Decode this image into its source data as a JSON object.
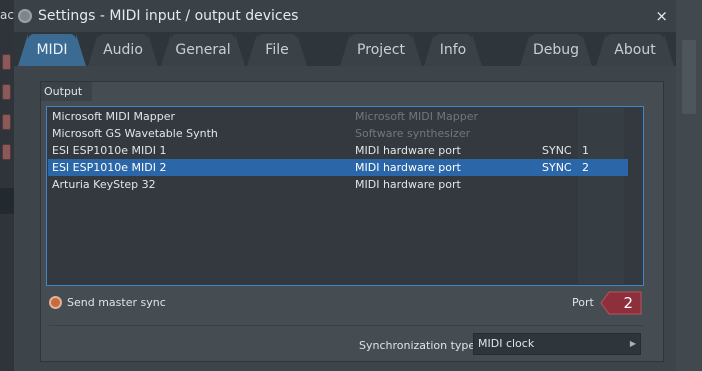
{
  "background": {
    "app_fragment": "ac"
  },
  "window": {
    "title": "Settings - MIDI input / output devices",
    "close_glyph": "×"
  },
  "tabs": [
    {
      "label": "MIDI",
      "active": true
    },
    {
      "label": "Audio",
      "active": false
    },
    {
      "label": "General",
      "active": false
    },
    {
      "label": "File",
      "active": false
    },
    {
      "label": "Project",
      "active": false
    },
    {
      "label": "Info",
      "active": false
    },
    {
      "label": "Debug",
      "active": false
    },
    {
      "label": "About",
      "active": false
    }
  ],
  "output": {
    "section_label": "Output",
    "devices": [
      {
        "name": "Microsoft MIDI Mapper",
        "type": "Microsoft MIDI Mapper",
        "sync": "",
        "port": "",
        "selected": false,
        "dim": true
      },
      {
        "name": "Microsoft GS Wavetable Synth",
        "type": "Software synthesizer",
        "sync": "",
        "port": "",
        "selected": false,
        "dim": true
      },
      {
        "name": "ESI ESP1010e MIDI 1",
        "type": "MIDI hardware port",
        "sync": "SYNC",
        "port": "1",
        "selected": false,
        "dim": false
      },
      {
        "name": "ESI ESP1010e MIDI 2",
        "type": "MIDI hardware port",
        "sync": "SYNC",
        "port": "2",
        "selected": true,
        "dim": false
      },
      {
        "name": "Arturia KeyStep 32",
        "type": "MIDI hardware port",
        "sync": "",
        "port": "",
        "selected": false,
        "dim": false
      }
    ],
    "send_master_sync_label": "Send master sync",
    "port_label": "Port",
    "port_value": "2",
    "sync_type_label": "Synchronization type",
    "sync_type_value": "MIDI clock"
  },
  "colors": {
    "accent": "#3b6a92",
    "selection": "#2a66a8",
    "list_border": "#3f86c8",
    "port_badge": "#8e2f3c",
    "radio": "#c96a3a"
  }
}
